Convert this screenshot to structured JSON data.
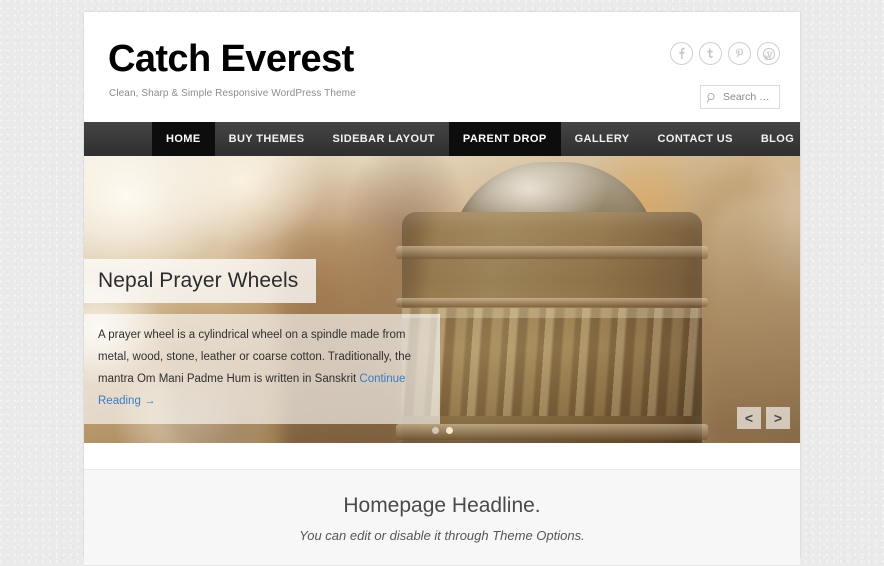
{
  "site": {
    "title": "Catch Everest",
    "description": "Clean, Sharp & Simple Responsive WordPress Theme"
  },
  "social": {
    "items": [
      {
        "name": "facebook-icon",
        "label": "f"
      },
      {
        "name": "twitter-icon",
        "label": "t"
      },
      {
        "name": "pinterest-icon",
        "label": "P"
      },
      {
        "name": "wordpress-icon",
        "label": "W"
      }
    ]
  },
  "search": {
    "placeholder": "Search …",
    "value": "",
    "icon": "search-icon"
  },
  "nav": {
    "items": [
      {
        "label": "HOME",
        "active": true
      },
      {
        "label": "BUY THEMES",
        "active": false
      },
      {
        "label": "SIDEBAR LAYOUT",
        "active": false
      },
      {
        "label": "PARENT DROP",
        "active": true
      },
      {
        "label": "GALLERY",
        "active": false
      },
      {
        "label": "CONTACT US",
        "active": false
      },
      {
        "label": "BLOG",
        "active": false
      }
    ]
  },
  "slider": {
    "slide": {
      "title": "Nepal Prayer Wheels",
      "description": "A prayer wheel is a cylindrical wheel on a spindle made from metal, wood, stone, leather or coarse cotton. Traditionally, the mantra Om Mani Padme Hum is written in Sanskrit ",
      "more_label": "Continue Reading →"
    },
    "controls": {
      "prev_label": "<",
      "next_label": ">"
    },
    "pager": {
      "count": 2,
      "active_index": 1
    }
  },
  "homepage_headline": {
    "title": "Homepage Headline.",
    "subtitle": "You can edit or disable it through Theme Options."
  },
  "colors": {
    "page_background": "#eaeaea",
    "content_background": "#ffffff",
    "nav_background": "#3a3a3a",
    "nav_active": "#0d0d0d",
    "link_blue": "#3b7cc4",
    "headline_band": "#f7f7f7"
  }
}
